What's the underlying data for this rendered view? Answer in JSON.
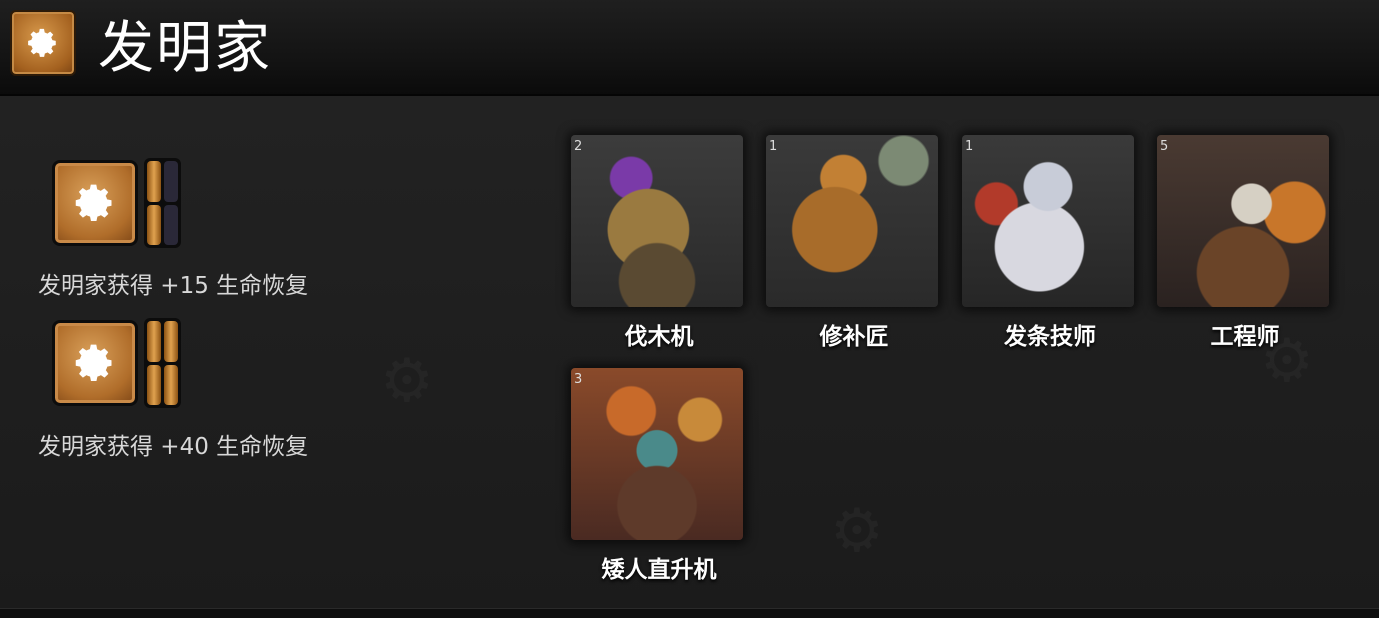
{
  "header": {
    "title": "发明家",
    "icon": "gear-icon"
  },
  "tiers": [
    {
      "description": "发明家获得 +15 生命恢复",
      "pips_on": 1,
      "pips_total": 2,
      "icon": "gear-icon"
    },
    {
      "description": "发明家获得 +40 生命恢复",
      "pips_on": 2,
      "pips_total": 2,
      "icon": "gear-icon"
    }
  ],
  "heroes": [
    {
      "name": "伐木机",
      "level": "2"
    },
    {
      "name": "修补匠",
      "level": "1"
    },
    {
      "name": "发条技师",
      "level": "1"
    },
    {
      "name": "工程师",
      "level": "5"
    },
    {
      "name": "矮人直升机",
      "level": "3"
    }
  ],
  "colors": {
    "accent": "#c4813a",
    "background": "#1c1c1c"
  }
}
